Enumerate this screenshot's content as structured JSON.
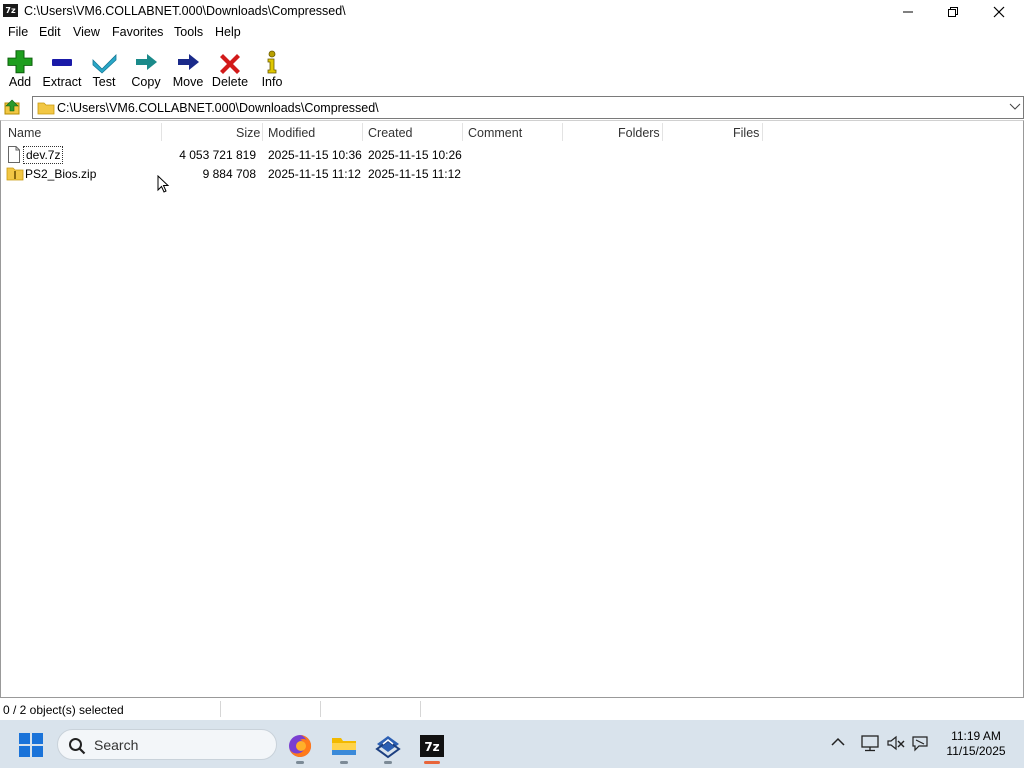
{
  "window": {
    "title": "C:\\Users\\VM6.COLLABNET.000\\Downloads\\Compressed\\",
    "app_icon_text": "7z"
  },
  "menu": [
    "File",
    "Edit",
    "View",
    "Favorites",
    "Tools",
    "Help"
  ],
  "toolbar": [
    {
      "label": "Add",
      "icon": "add-icon",
      "color": "#1e9e1e"
    },
    {
      "label": "Extract",
      "icon": "extract-icon",
      "color": "#1a1aa8"
    },
    {
      "label": "Test",
      "icon": "test-icon",
      "color": "#2aa8c8"
    },
    {
      "label": "Copy",
      "icon": "copy-icon",
      "color": "#1a8a8a"
    },
    {
      "label": "Move",
      "icon": "move-icon",
      "color": "#1a2a8a"
    },
    {
      "label": "Delete",
      "icon": "delete-icon",
      "color": "#d21a1a"
    },
    {
      "label": "Info",
      "icon": "info-icon",
      "color": "#b8a000"
    }
  ],
  "address": {
    "path": "C:\\Users\\VM6.COLLABNET.000\\Downloads\\Compressed\\"
  },
  "columns": [
    "Name",
    "Size",
    "Modified",
    "Created",
    "Comment",
    "Folders",
    "Files"
  ],
  "files": [
    {
      "name": "dev.7z",
      "size": "4 053 721 819",
      "modified": "2025-11-15 10:36",
      "created": "2025-11-15 10:26",
      "type": "file"
    },
    {
      "name": "PS2_Bios.zip",
      "size": "9 884 708",
      "modified": "2025-11-15 11:12",
      "created": "2025-11-15 11:12",
      "type": "zip-folder"
    }
  ],
  "status": {
    "selection": "0 / 2 object(s) selected"
  },
  "taskbar": {
    "search_placeholder": "Search",
    "time": "11:19 AM",
    "date": "11/15/2025",
    "apps": [
      "firefox-icon",
      "file-explorer-icon",
      "vm-app-icon",
      "7zip-icon"
    ]
  },
  "colors": {
    "taskbar_bg": "#d9e3ec",
    "active_indicator": "#e8653a",
    "folder_yellow": "#f2c744"
  }
}
